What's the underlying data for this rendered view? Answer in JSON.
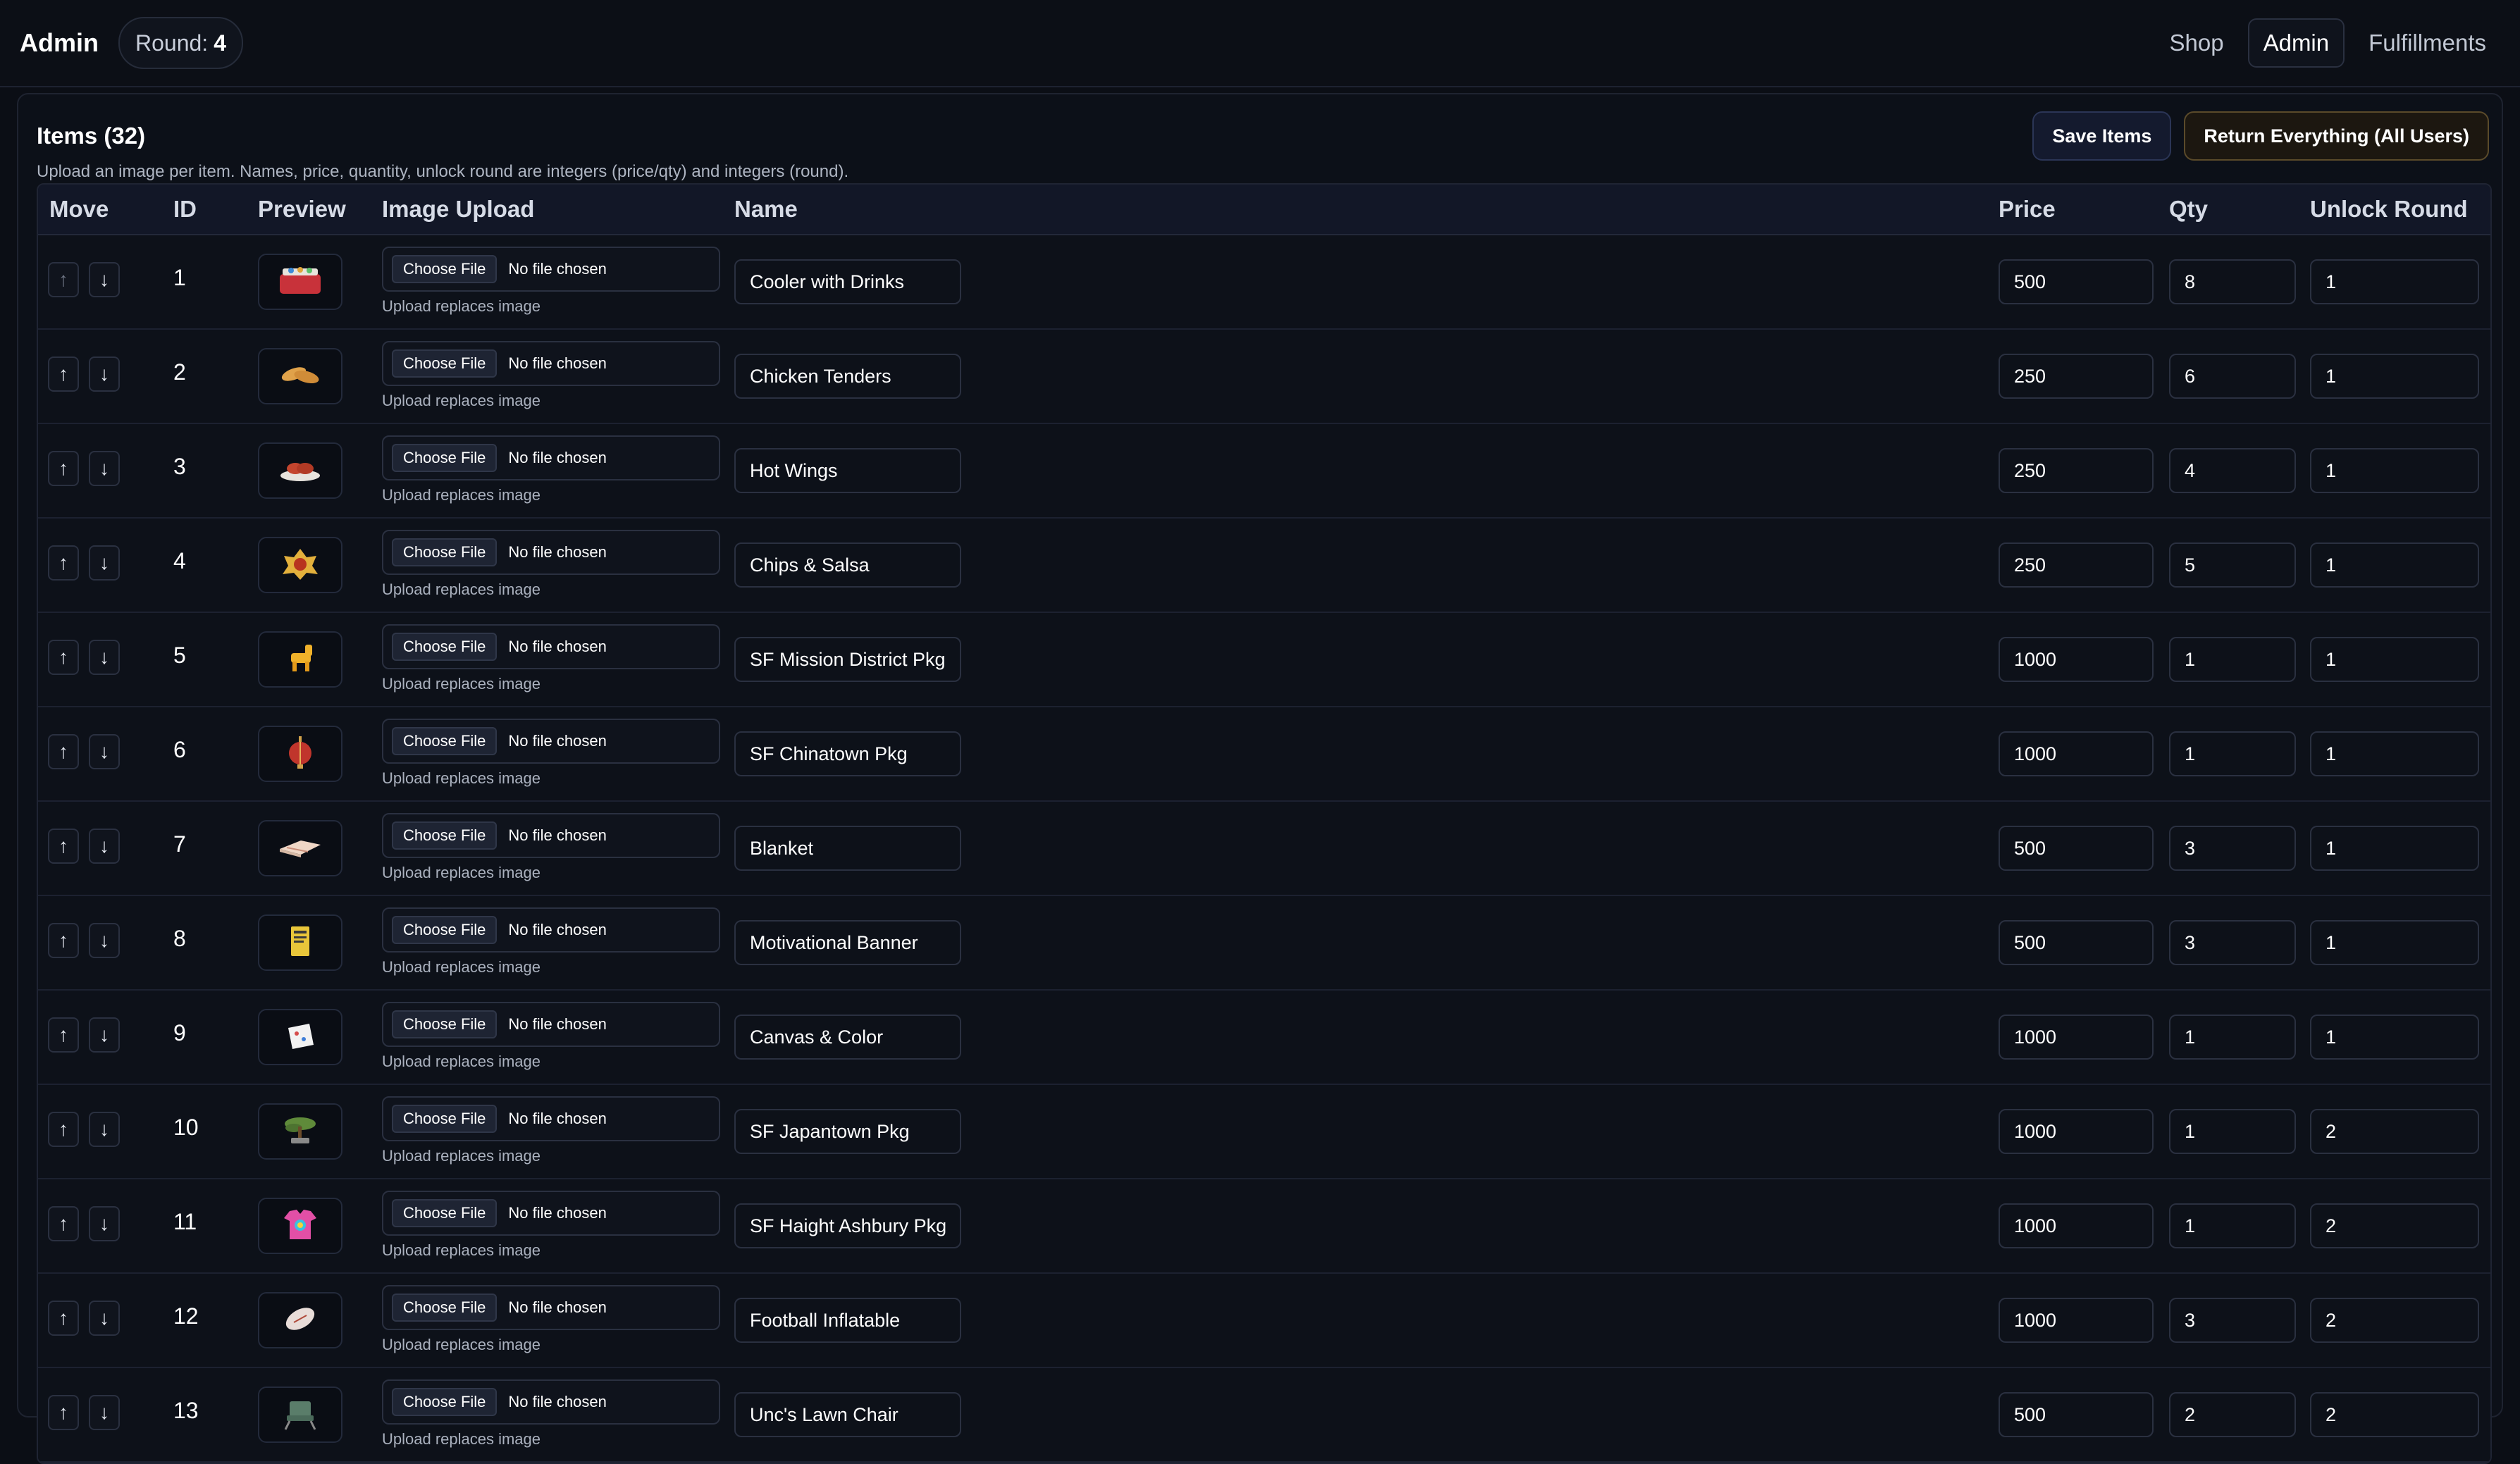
{
  "header": {
    "brand": "Admin",
    "round_label": "Round:",
    "round_value": "4",
    "nav": [
      {
        "label": "Shop"
      },
      {
        "label": "Admin"
      },
      {
        "label": "Fulfillments"
      }
    ]
  },
  "panel": {
    "title": "Items (32)",
    "save_label": "Save Items",
    "return_label": "Return Everything (All Users)",
    "description": "Upload an image per item. Names, price, quantity, unlock round are integers (price/qty) and integers (round)."
  },
  "table": {
    "columns": [
      "Move",
      "ID",
      "Preview",
      "Image Upload",
      "Name",
      "Price",
      "Qty",
      "Unlock Round"
    ],
    "up_glyph": "↑",
    "down_glyph": "↓",
    "choose_label": "Choose File",
    "no_file_label": "No file chosen",
    "upload_hint": "Upload replaces image",
    "rows": [
      {
        "id": "1",
        "name": "Cooler with Drinks",
        "price": "500",
        "qty": "8",
        "round": "1",
        "icon": "cooler-icon"
      },
      {
        "id": "2",
        "name": "Chicken Tenders",
        "price": "250",
        "qty": "6",
        "round": "1",
        "icon": "tenders-icon"
      },
      {
        "id": "3",
        "name": "Hot Wings",
        "price": "250",
        "qty": "4",
        "round": "1",
        "icon": "wings-icon"
      },
      {
        "id": "4",
        "name": "Chips & Salsa",
        "price": "250",
        "qty": "5",
        "round": "1",
        "icon": "chips-icon"
      },
      {
        "id": "5",
        "name": "SF Mission District Pkg",
        "price": "1000",
        "qty": "1",
        "round": "1",
        "icon": "pinata-icon"
      },
      {
        "id": "6",
        "name": "SF Chinatown Pkg",
        "price": "1000",
        "qty": "1",
        "round": "1",
        "icon": "lantern-icon"
      },
      {
        "id": "7",
        "name": "Blanket",
        "price": "500",
        "qty": "3",
        "round": "1",
        "icon": "blanket-icon"
      },
      {
        "id": "8",
        "name": "Motivational Banner",
        "price": "500",
        "qty": "3",
        "round": "1",
        "icon": "banner-icon"
      },
      {
        "id": "9",
        "name": "Canvas & Color",
        "price": "1000",
        "qty": "1",
        "round": "1",
        "icon": "canvas-icon"
      },
      {
        "id": "10",
        "name": "SF Japantown Pkg",
        "price": "1000",
        "qty": "1",
        "round": "2",
        "icon": "bonsai-icon"
      },
      {
        "id": "11",
        "name": "SF Haight Ashbury Pkg",
        "price": "1000",
        "qty": "1",
        "round": "2",
        "icon": "tiedye-shirt-icon"
      },
      {
        "id": "12",
        "name": "Football Inflatable",
        "price": "1000",
        "qty": "3",
        "round": "2",
        "icon": "football-icon"
      },
      {
        "id": "13",
        "name": "Unc's Lawn Chair",
        "price": "500",
        "qty": "2",
        "round": "2",
        "icon": "lawn-chair-icon"
      }
    ]
  }
}
